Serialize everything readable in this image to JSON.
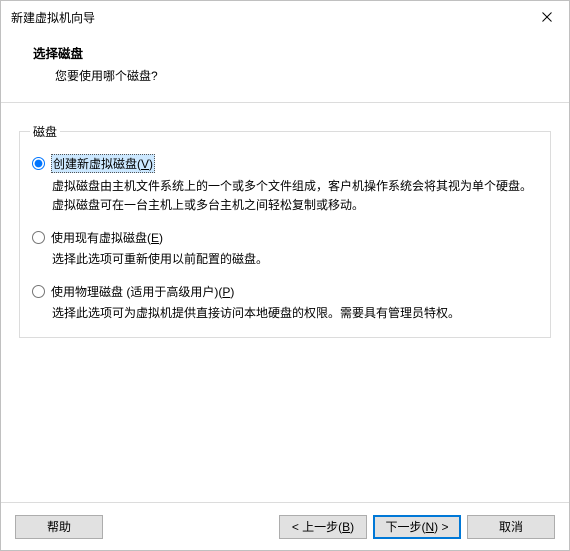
{
  "window": {
    "title": "新建虚拟机向导"
  },
  "header": {
    "heading": "选择磁盘",
    "subheading": "您要使用哪个磁盘?"
  },
  "group": {
    "legend": "磁盘",
    "options": [
      {
        "label_pre": "创建新虚拟磁盘(",
        "label_key": "V",
        "label_post": ")",
        "desc": "虚拟磁盘由主机文件系统上的一个或多个文件组成，客户机操作系统会将其视为单个硬盘。虚拟磁盘可在一台主机上或多台主机之间轻松复制或移动。",
        "selected": true
      },
      {
        "label_pre": "使用现有虚拟磁盘(",
        "label_key": "E",
        "label_post": ")",
        "desc": "选择此选项可重新使用以前配置的磁盘。",
        "selected": false
      },
      {
        "label_pre": "使用物理磁盘 (适用于高级用户)(",
        "label_key": "P",
        "label_post": ")",
        "desc": "选择此选项可为虚拟机提供直接访问本地硬盘的权限。需要具有管理员特权。",
        "selected": false
      }
    ]
  },
  "buttons": {
    "help": "帮助",
    "back_pre": "< 上一步(",
    "back_key": "B",
    "back_post": ")",
    "next_pre": "下一步(",
    "next_key": "N",
    "next_post": ") >",
    "cancel": "取消"
  }
}
